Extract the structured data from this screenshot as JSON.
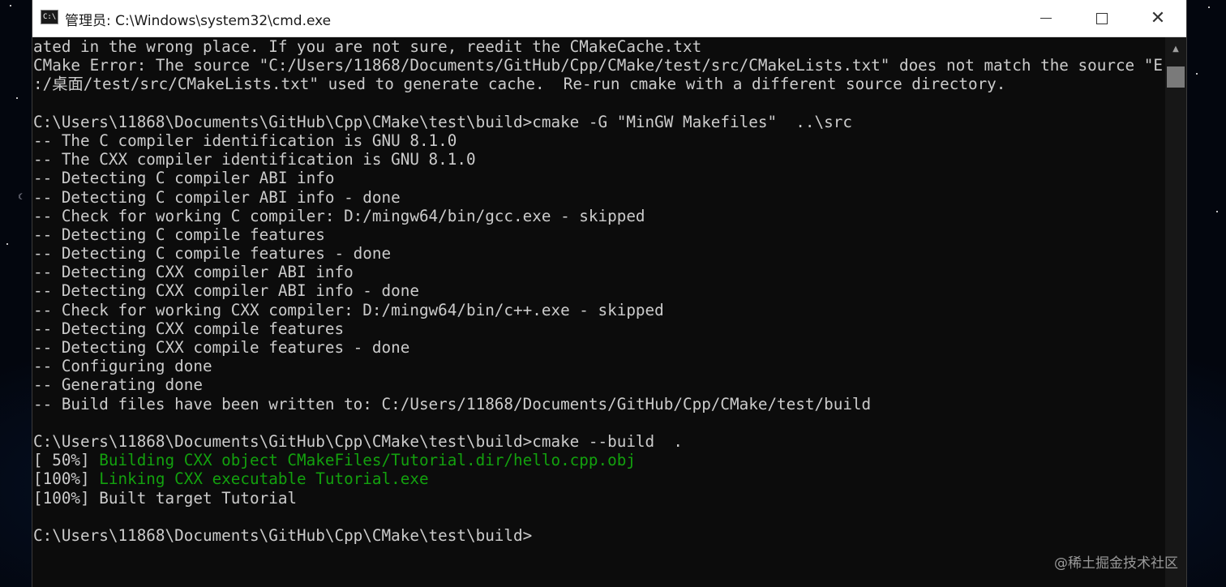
{
  "window": {
    "title": "管理员: C:\\Windows\\system32\\cmd.exe",
    "icon_label": "C:\\",
    "buttons": {
      "minimize": "minimize-icon",
      "maximize": "maximize-icon",
      "close": "✕"
    }
  },
  "console": {
    "lines": [
      {
        "text": "ated in the wrong place. If you are not sure, reedit the CMakeCache.txt"
      },
      {
        "text": "CMake Error: The source \"C:/Users/11868/Documents/GitHub/Cpp/CMake/test/src/CMakeLists.txt\" does not match the source \"E"
      },
      {
        "text": ":/桌面/test/src/CMakeLists.txt\" used to generate cache.  Re-run cmake with a different source directory."
      },
      {
        "text": ""
      },
      {
        "text": "C:\\Users\\11868\\Documents\\GitHub\\Cpp\\CMake\\test\\build>cmake -G \"MinGW Makefiles\"  ..\\src"
      },
      {
        "text": "-- The C compiler identification is GNU 8.1.0"
      },
      {
        "text": "-- The CXX compiler identification is GNU 8.1.0"
      },
      {
        "text": "-- Detecting C compiler ABI info"
      },
      {
        "text": "-- Detecting C compiler ABI info - done"
      },
      {
        "text": "-- Check for working C compiler: D:/mingw64/bin/gcc.exe - skipped"
      },
      {
        "text": "-- Detecting C compile features"
      },
      {
        "text": "-- Detecting C compile features - done"
      },
      {
        "text": "-- Detecting CXX compiler ABI info"
      },
      {
        "text": "-- Detecting CXX compiler ABI info - done"
      },
      {
        "text": "-- Check for working CXX compiler: D:/mingw64/bin/c++.exe - skipped"
      },
      {
        "text": "-- Detecting CXX compile features"
      },
      {
        "text": "-- Detecting CXX compile features - done"
      },
      {
        "text": "-- Configuring done"
      },
      {
        "text": "-- Generating done"
      },
      {
        "text": "-- Build files have been written to: C:/Users/11868/Documents/GitHub/Cpp/CMake/test/build"
      },
      {
        "text": ""
      },
      {
        "text": "C:\\Users\\11868\\Documents\\GitHub\\Cpp\\CMake\\test\\build>cmake --build  ."
      },
      {
        "prefix": "[ 50%] ",
        "green": "Building CXX object CMakeFiles/Tutorial.dir/hello.cpp.obj"
      },
      {
        "prefix": "[100%] ",
        "green": "Linking CXX executable Tutorial.exe"
      },
      {
        "text": "[100%] Built target Tutorial"
      },
      {
        "text": ""
      },
      {
        "text": "C:\\Users\\11868\\Documents\\GitHub\\Cpp\\CMake\\test\\build>"
      }
    ]
  },
  "colors": {
    "console_bg": "#0c0c0c",
    "console_text": "#cccccc",
    "green_text": "#13a10e",
    "titlebar_bg": "#ffffff"
  },
  "watermark": "@稀土掘金技术社区"
}
